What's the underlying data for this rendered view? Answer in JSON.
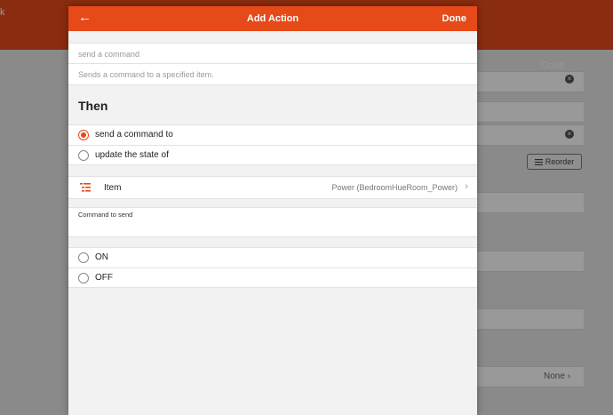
{
  "background": {
    "back_label": "k",
    "tab_code": "Code",
    "reorder_label": "Reorder",
    "none_value": "None",
    "chevron": "›",
    "clear_glyph": "×"
  },
  "modal": {
    "title": "Add Action",
    "back_icon": "←",
    "done_label": "Done",
    "command_placeholder": "send a command",
    "description_placeholder": "Sends a command to a specified item.",
    "section_title": "Then",
    "mode_options": [
      {
        "label": "send a command to",
        "selected": true
      },
      {
        "label": "update the state of",
        "selected": false
      }
    ],
    "item": {
      "label": "Item",
      "value": "Power (BedroomHueRoom_Power)",
      "chevron": "›",
      "icon": "list-icon"
    },
    "command_label": "Command to send",
    "command_options": [
      {
        "label": "ON",
        "selected": false
      },
      {
        "label": "OFF",
        "selected": false
      }
    ]
  },
  "colors": {
    "accent": "#e64a19",
    "overlay": "rgba(0,0,0,0.40)"
  }
}
